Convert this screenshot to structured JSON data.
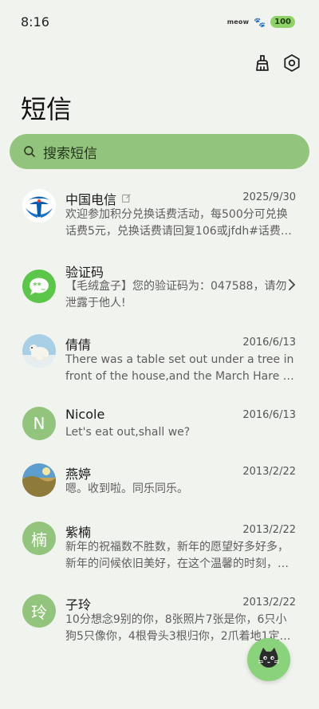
{
  "status": {
    "time": "8:16",
    "carrier": "meow",
    "battery": "100"
  },
  "toolbar": {
    "clean_icon": "broom-icon",
    "settings_icon": "settings-icon"
  },
  "page": {
    "title": "短信"
  },
  "search": {
    "placeholder": "搜索短信"
  },
  "colors": {
    "accent": "#93c47d",
    "background": "#f1f3ee",
    "fab": "#8ad27c"
  },
  "conversations": [
    {
      "name": "中国电信",
      "date": "2025/9/30",
      "preview": "欢迎参加积分兑换话费活动，每500分可兑换话费5元，兑换话费请回复106或jfdh#话费…",
      "avatar": "china-telecom-logo"
    },
    {
      "name": "验证码",
      "date": "",
      "preview": "【毛绒盒子】您的验证码为：047588，请勿泄露于他人!",
      "avatar": "message-bubble-icon"
    },
    {
      "name": "倩倩",
      "date": "2016/6/13",
      "preview": "There was a table set out under a tree in front of the house,and the March Hare an…",
      "avatar": "polar-bear-photo"
    },
    {
      "name": "Nicole",
      "date": "2016/6/13",
      "preview": "Let's eat out,shall we?",
      "avatar_letter": "N"
    },
    {
      "name": "燕婷",
      "date": "2013/2/22",
      "preview": "嗯。收到啦。同乐同乐。",
      "avatar": "landscape-photo"
    },
    {
      "name": "紫楠",
      "date": "2013/2/22",
      "preview": "新年的祝福数不胜数，新年的愿望好多好多，新年的问候依旧美好，在这个温馨的时刻，…",
      "avatar_letter": "楠"
    },
    {
      "name": "子玲",
      "date": "2013/2/22",
      "preview": "10分想念9别的你，8张照片7张是你，6只小狗5只像你，4根骨头3根归你，2爪着地1定…",
      "avatar_letter": "玲"
    }
  ],
  "fab": {
    "icon": "cat-face-icon"
  }
}
